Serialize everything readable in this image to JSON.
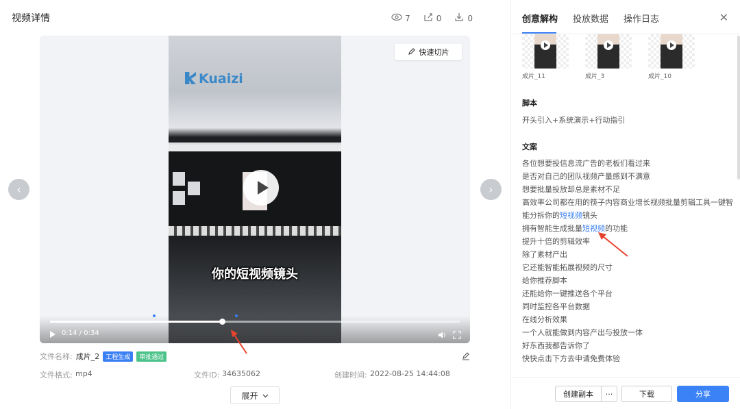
{
  "header": {
    "title": "视频详情",
    "stats": {
      "views": "7",
      "shares": "0",
      "downloads": "0"
    }
  },
  "player": {
    "quick_cut_label": "快速切片",
    "logo_text": "Kuaizi",
    "subtitle": "你的短视频镜头",
    "current_time": "0:14",
    "separator": "/",
    "duration": "0:34",
    "progress_fraction": 0.42
  },
  "meta": {
    "file_name_label": "文件名称:",
    "file_name": "成片_2",
    "tag_engineering": "工程生成",
    "tag_approved": "审批通过",
    "format_label": "文件格式:",
    "format": "mp4",
    "file_id_label": "文件ID:",
    "file_id": "34635062",
    "created_label": "创建时间:",
    "created": "2022-08-25 14:44:08",
    "expand_label": "展开"
  },
  "panel": {
    "tabs": [
      {
        "label": "创意解构"
      },
      {
        "label": "投放数据"
      },
      {
        "label": "操作日志"
      }
    ],
    "thumbnails": [
      {
        "label": "成片_11"
      },
      {
        "label": "成片_3"
      },
      {
        "label": "成片_10"
      }
    ],
    "script_title": "脚本",
    "script_text": "开头引入+系统演示+行动指引",
    "copy_title": "文案",
    "copy_lines": [
      "各位想要投信息流广告的老板们看过来",
      "是否对自己的团队视频产量感到不满意",
      "想要批量投放却总是素材不足",
      "高效率公司都在用的筷子内容商业增长视频批量剪辑工具一键智",
      "能分拆你的",
      "短视频",
      "镜头",
      "拥有智能生成批量",
      "短视频",
      "的功能",
      "提升十倍的剪辑效率",
      "除了素材产出",
      "它还能智能拓展视频的尺寸",
      "给你推荐脚本",
      "还能给你一键推送各个平台",
      "同时监控各平台数据",
      "在线分析效果",
      "一个人就能做到内容产出与投放一体",
      "好东西我都告诉你了",
      "快快点击下方去申请免费体验"
    ]
  },
  "footer": {
    "create_copy": "创建副本",
    "more": "···",
    "download": "下载",
    "share": "分享"
  },
  "colors": {
    "accent": "#3b7ff5",
    "tag_green": "#4cc38a",
    "annotation_red": "#e8432e"
  }
}
